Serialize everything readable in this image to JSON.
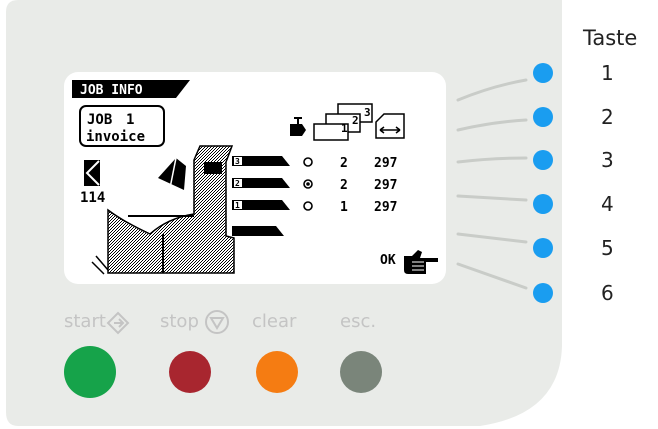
{
  "taste": {
    "title": "Taste",
    "keys": [
      "1",
      "2",
      "3",
      "4",
      "5",
      "6"
    ]
  },
  "screen": {
    "header": "JOB INFO",
    "job_label": "JOB",
    "job_number": "1",
    "job_name": "invoice",
    "counter": "114",
    "ok_label": "OK",
    "feeders": [
      {
        "station": "3",
        "mode": "off",
        "sheets": "2",
        "length": "297"
      },
      {
        "station": "2",
        "mode": "on",
        "sheets": "2",
        "length": "297"
      },
      {
        "station": "1",
        "mode": "off",
        "sheets": "1",
        "length": "297"
      }
    ],
    "mini_stack_digits": [
      "1",
      "2",
      "3"
    ]
  },
  "controls": {
    "start": {
      "label": "start",
      "color": "#16a34a",
      "icon": "diamond-arrow-icon"
    },
    "stop": {
      "label": "stop",
      "color": "#a8262f",
      "icon": "circle-triangle-icon"
    },
    "clear": {
      "label": "clear",
      "color": "#f57c12"
    },
    "esc": {
      "label": "esc.",
      "color": "#7a857a"
    }
  },
  "colors": {
    "panel": "#e9ebe8",
    "indicator": "#1a9df0",
    "lcd_bg": "#ffffff",
    "lcd_ink": "#000000"
  }
}
